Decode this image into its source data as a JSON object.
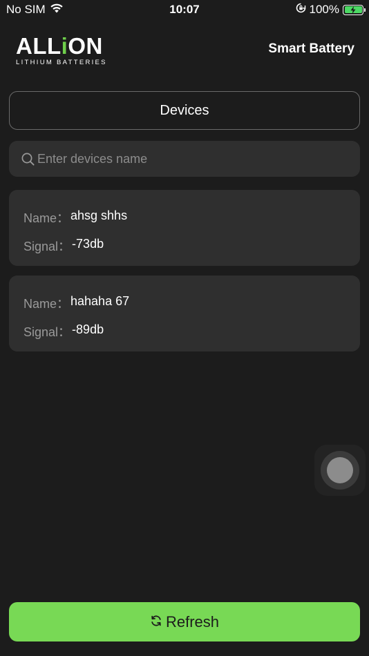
{
  "status_bar": {
    "carrier": "No SIM",
    "time": "10:07",
    "battery_percent": "100%",
    "battery_level": 1.0,
    "icons": [
      "wifi-icon",
      "orientation-lock-icon",
      "battery-charging-icon"
    ]
  },
  "header": {
    "logo_main_prefix": "ALL",
    "logo_main_accent": "i",
    "logo_main_suffix": "ON",
    "logo_sub": "LITHIUM BATTERIES",
    "title": "Smart Battery"
  },
  "tabs": {
    "devices": "Devices"
  },
  "search": {
    "placeholder": "Enter devices name",
    "value": "",
    "icon": "search-icon"
  },
  "devices": [
    {
      "name_label": "Name：",
      "name": "ahsg shhs",
      "signal_label": "Signal：",
      "signal": "-73db"
    },
    {
      "name_label": "Name：",
      "name": "hahaha 67",
      "signal_label": "Signal：",
      "signal": "-89db"
    }
  ],
  "refresh": {
    "label": "Refresh",
    "icon": "refresh-icon"
  },
  "colors": {
    "background": "#1c1c1c",
    "card": "#2f2f2f",
    "accent": "#78d955",
    "logo_accent": "#6fcf4b",
    "label": "#9a9a9a"
  }
}
